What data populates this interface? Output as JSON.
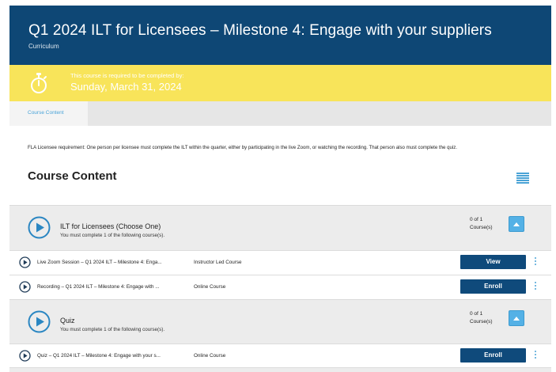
{
  "header": {
    "title": "Q1 2024 ILT for Licensees – Milestone 4: Engage with your suppliers",
    "subtitle": "Curriculum"
  },
  "due": {
    "icon": "stopwatch-icon",
    "label": "This course is required to be completed by:",
    "date": "Sunday, March 31, 2024"
  },
  "tabs": [
    {
      "label": "Course Content",
      "active": true
    }
  ],
  "main": {
    "requirement": "FLA Licensee requirement: One person per licensee must complete the ILT within the quarter, either by participating in the live Zoom, or watching the recording. That person also must complete the quiz.",
    "section_title": "Course Content",
    "list_icon": "list-view-icon"
  },
  "groups": [
    {
      "name": "ILT for Licensees (Choose One)",
      "description": "You must complete 1 of the following course(s).",
      "count_line1": "0 of 1",
      "count_line2": "Course(s)",
      "courses": [
        {
          "name": "Live Zoom Session – Q1 2024 ILT – Milestone 4: Enga...",
          "type": "Instructor Led Course",
          "action": "View"
        },
        {
          "name": "Recording – Q1 2024 ILT – Milestone 4: Engage with ...",
          "type": "Online Course",
          "action": "Enroll"
        }
      ]
    },
    {
      "name": "Quiz",
      "description": "You must complete 1 of the following course(s).",
      "count_line1": "0 of 1",
      "count_line2": "Course(s)",
      "courses": [
        {
          "name": "Quiz – Q1 2024 ILT – Milestone 4: Engage with your s...",
          "type": "Online Course",
          "action": "Enroll"
        }
      ]
    }
  ],
  "colors": {
    "header_bg": "#0e4775",
    "due_bg": "#f8e45a",
    "accent": "#4aa3d6",
    "button_bg": "#0f4a7b"
  }
}
